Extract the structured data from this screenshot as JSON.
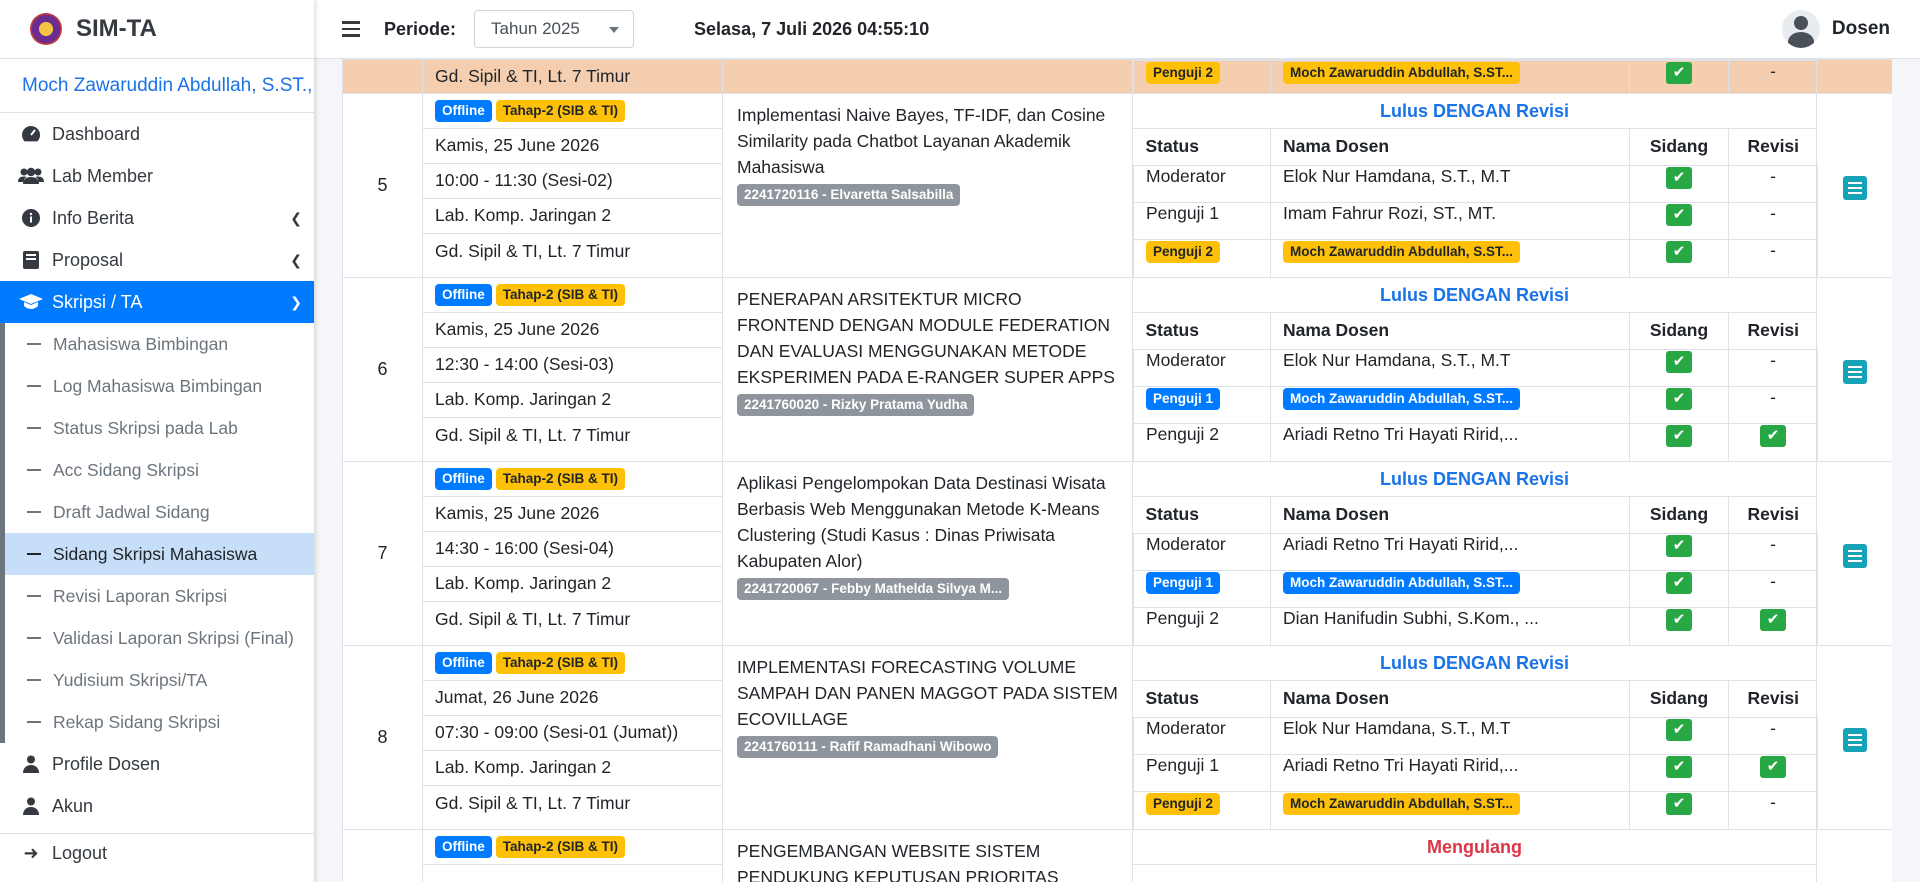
{
  "brand": {
    "name": "SIM-TA"
  },
  "user": {
    "name": "Moch Zawaruddin Abdullah, S.ST., M"
  },
  "nav": {
    "dashboard": "Dashboard",
    "lab_member": "Lab Member",
    "info_berita": "Info Berita",
    "proposal": "Proposal",
    "skripsi": "Skripsi / TA",
    "sub": [
      "Mahasiswa Bimbingan",
      "Log Mahasiswa Bimbingan",
      "Status Skripsi pada Lab",
      "Acc Sidang Skripsi",
      "Draft Jadwal Sidang",
      "Sidang Skripsi Mahasiswa",
      "Revisi Laporan Skripsi",
      "Validasi Laporan Skripsi (Final)",
      "Yudisium Skripsi/TA",
      "Rekap Sidang Skripsi"
    ],
    "profile_dosen": "Profile Dosen",
    "akun": "Akun",
    "logout": "Logout"
  },
  "topbar": {
    "periode_label": "Periode:",
    "periode_value": "Tahun 2025",
    "datetime": "Selasa, 7 Juli 2026 04:55:10",
    "role": "Dosen"
  },
  "headers": {
    "status": "Status",
    "nama": "Nama Dosen",
    "sidang": "Sidang",
    "revisi": "Revisi"
  },
  "prev_row": {
    "lokasi": "Gd. Sipil & TI, Lt. 7 Timur",
    "status": "Penguji 2",
    "nama": "Moch Zawaruddin Abdullah, S.ST...",
    "revisi": "-"
  },
  "rows": [
    {
      "no": "5",
      "mode": "Offline",
      "tahap": "Tahap-2 (SIB & TI)",
      "tanggal": "Kamis, 25 June 2026",
      "sesi": "10:00 - 11:30 (Sesi-02)",
      "ruang": "Lab. Komp. Jaringan 2",
      "gedung": "Gd. Sipil & TI, Lt. 7 Timur",
      "judul": "Implementasi Naive Bayes, TF-IDF, dan Cosine Similarity pada Chatbot Layanan Akademik Mahasiswa",
      "nim": "2241720116 - Elvaretta Salsabilla",
      "hasil": "Lulus DENGAN Revisi",
      "penguji": [
        {
          "status": "Moderator",
          "nama": "Elok Nur Hamdana, S.T., M.T",
          "revisi": "-"
        },
        {
          "status": "Penguji 1",
          "nama": "Imam Fahrur Rozi, ST., MT.",
          "revisi": "-"
        },
        {
          "status": "Penguji 2",
          "nama": "Moch Zawaruddin Abdullah, S.ST...",
          "revisi": "-"
        }
      ]
    },
    {
      "no": "6",
      "mode": "Offline",
      "tahap": "Tahap-2 (SIB & TI)",
      "tanggal": "Kamis, 25 June 2026",
      "sesi": "12:30 - 14:00 (Sesi-03)",
      "ruang": "Lab. Komp. Jaringan 2",
      "gedung": "Gd. Sipil & TI, Lt. 7 Timur",
      "judul": "PENERAPAN ARSITEKTUR MICRO FRONTEND DENGAN MODULE FEDERATION DAN EVALUASI MENGGUNAKAN METODE EKSPERIMEN PADA E-RANGER SUPER APPS",
      "nim": "2241760020 - Rizky Pratama Yudha",
      "hasil": "Lulus DENGAN Revisi",
      "penguji": [
        {
          "status": "Moderator",
          "nama": "Elok Nur Hamdana, S.T., M.T",
          "revisi": "-"
        },
        {
          "status": "Penguji 1",
          "nama": "Moch Zawaruddin Abdullah, S.ST...",
          "revisi": "-"
        },
        {
          "status": "Penguji 2",
          "nama": "Ariadi Retno Tri Hayati Ririd,...",
          "revisi": ""
        }
      ]
    },
    {
      "no": "7",
      "mode": "Offline",
      "tahap": "Tahap-2 (SIB & TI)",
      "tanggal": "Kamis, 25 June 2026",
      "sesi": "14:30 - 16:00 (Sesi-04)",
      "ruang": "Lab. Komp. Jaringan 2",
      "gedung": "Gd. Sipil & TI, Lt. 7 Timur",
      "judul": "Aplikasi Pengelompokan Data Destinasi Wisata Berbasis Web Menggunakan Metode K-Means Clustering (Studi Kasus : Dinas Priwisata Kabupaten Alor)",
      "nim": "2241720067 - Febby Mathelda Silvya M...",
      "hasil": "Lulus DENGAN Revisi",
      "penguji": [
        {
          "status": "Moderator",
          "nama": "Ariadi Retno Tri Hayati Ririd,...",
          "revisi": "-"
        },
        {
          "status": "Penguji 1",
          "nama": "Moch Zawaruddin Abdullah, S.ST...",
          "revisi": "-"
        },
        {
          "status": "Penguji 2",
          "nama": "Dian Hanifudin Subhi, S.Kom., ...",
          "revisi": ""
        }
      ]
    },
    {
      "no": "8",
      "mode": "Offline",
      "tahap": "Tahap-2 (SIB & TI)",
      "tanggal": "Jumat, 26 June 2026",
      "sesi": "07:30 - 09:00 (Sesi-01 (Jumat))",
      "ruang": "Lab. Komp. Jaringan 2",
      "gedung": "Gd. Sipil & TI, Lt. 7 Timur",
      "judul": "IMPLEMENTASI FORECASTING VOLUME SAMPAH DAN PANEN MAGGOT PADA SISTEM ECOVILLAGE",
      "nim": "2241760111 - Rafif Ramadhani Wibowo",
      "hasil": "Lulus DENGAN Revisi",
      "penguji": [
        {
          "status": "Moderator",
          "nama": "Elok Nur Hamdana, S.T., M.T",
          "revisi": "-"
        },
        {
          "status": "Penguji 1",
          "nama": "Ariadi Retno Tri Hayati Ririd,...",
          "revisi": ""
        },
        {
          "status": "Penguji 2",
          "nama": "Moch Zawaruddin Abdullah, S.ST...",
          "revisi": "-"
        }
      ]
    },
    {
      "mode": "Offline",
      "tahap": "Tahap-2 (SIB & TI)",
      "judul": "PENGEMBANGAN WEBSITE SISTEM PENDUKUNG KEPUTUSAN PRIORITAS PELANGGAN PADA",
      "hasil": "Mengulang"
    }
  ]
}
